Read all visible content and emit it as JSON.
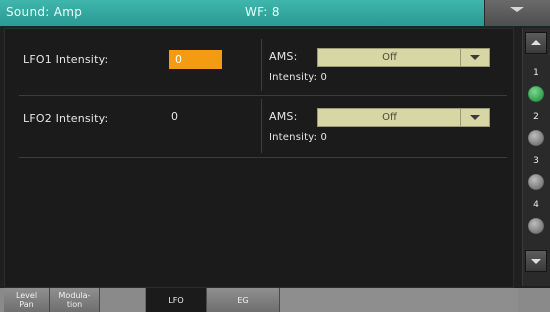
{
  "header": {
    "title": "Sound: Amp",
    "wf": "WF: 8"
  },
  "lfo1": {
    "label": "LFO1 Intensity:",
    "value": "0",
    "ams_label": "AMS:",
    "ams_value": "Off",
    "intensity_label": "Intensity: 0"
  },
  "lfo2": {
    "label": "LFO2 Intensity:",
    "value": "0",
    "ams_label": "AMS:",
    "ams_value": "Off",
    "intensity_label": "Intensity: 0"
  },
  "pages": [
    {
      "number": "1",
      "active": true
    },
    {
      "number": "2",
      "active": false
    },
    {
      "number": "3",
      "active": false
    },
    {
      "number": "4",
      "active": false
    }
  ],
  "tabs": [
    {
      "line1": "Level",
      "line2": "Pan"
    },
    {
      "line1": "Modula-",
      "line2": "tion"
    },
    {
      "line1": "LFO",
      "line2": ""
    },
    {
      "line1": "EG",
      "line2": ""
    }
  ],
  "colors": {
    "header": "#2fa79e",
    "selected_value": "#f39c12",
    "dropdown": "#d7d7a6",
    "active_page": "#2f9c4d"
  }
}
